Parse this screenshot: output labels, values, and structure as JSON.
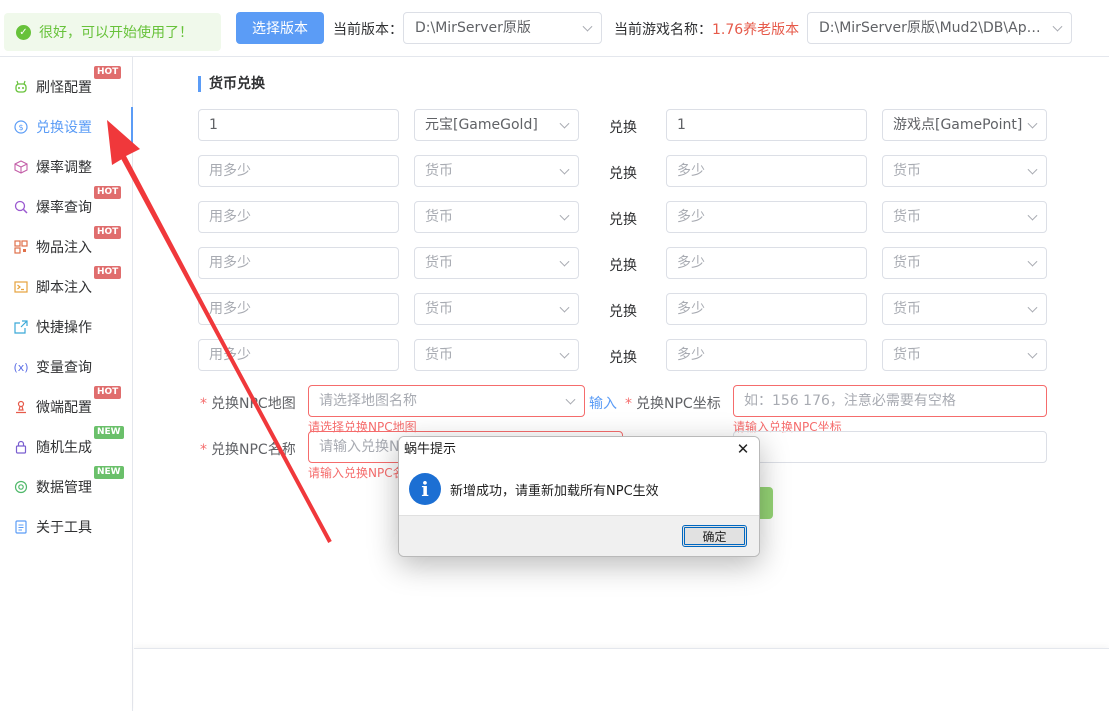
{
  "toast": {
    "text": "很好，可以开始使用了！"
  },
  "topbar": {
    "select_version_button": "选择版本",
    "current_version_label": "当前版本：",
    "current_version_value": "D:\\MirServer原版",
    "game_name_label": "当前游戏名称：",
    "game_name_value": "1.76养老版本",
    "db_path_value": "D:\\MirServer原版\\Mud2\\DB\\Apex..."
  },
  "sidebar": {
    "items": [
      {
        "label": "刷怪配置",
        "icon": "monster-icon",
        "badge": "HOT"
      },
      {
        "label": "兑换设置",
        "icon": "exchange-icon",
        "badge": ""
      },
      {
        "label": "爆率调整",
        "icon": "box-icon",
        "badge": ""
      },
      {
        "label": "爆率查询",
        "icon": "search-icon",
        "badge": "HOT"
      },
      {
        "label": "物品注入",
        "icon": "qrcode-icon",
        "badge": "HOT"
      },
      {
        "label": "脚本注入",
        "icon": "terminal-icon",
        "badge": "HOT"
      },
      {
        "label": "快捷操作",
        "icon": "external-link-icon",
        "badge": ""
      },
      {
        "label": "变量查询",
        "icon": "variable-icon",
        "badge": ""
      },
      {
        "label": "微端配置",
        "icon": "stamp-icon",
        "badge": "HOT"
      },
      {
        "label": "随机生成",
        "icon": "lock-icon",
        "badge": "NEW"
      },
      {
        "label": "数据管理",
        "icon": "database-icon",
        "badge": "NEW"
      },
      {
        "label": "关于工具",
        "icon": "document-icon",
        "badge": ""
      }
    ]
  },
  "section": {
    "title": "货币兑换"
  },
  "exchange": {
    "word": "兑换",
    "rows": [
      {
        "amount_from": "1",
        "currency_from": "元宝[GameGold]",
        "amount_to": "1",
        "currency_to": "游戏点[GamePoint]"
      },
      {
        "amount_from": "",
        "currency_from": "",
        "amount_to": "",
        "currency_to": ""
      },
      {
        "amount_from": "",
        "currency_from": "",
        "amount_to": "",
        "currency_to": ""
      },
      {
        "amount_from": "",
        "currency_from": "",
        "amount_to": "",
        "currency_to": ""
      },
      {
        "amount_from": "",
        "currency_from": "",
        "amount_to": "",
        "currency_to": ""
      },
      {
        "amount_from": "",
        "currency_from": "",
        "amount_to": "",
        "currency_to": ""
      }
    ],
    "placeholder_from": "用多少",
    "placeholder_currency": "货币",
    "placeholder_to": "多少"
  },
  "npc": {
    "map_label": "兑换NPC地图",
    "map_placeholder": "请选择地图名称",
    "map_error": "请选择兑换NPC地图",
    "input_link": "输入",
    "coord_label": "兑换NPC坐标",
    "coord_placeholder": "如：156 176，注意必需要有空格",
    "coord_error": "请输入兑换NPC坐标",
    "name_label": "兑换NPC名称",
    "name_placeholder": "请输入兑换NPC名称",
    "name_error": "请输入兑换NPC名称"
  },
  "dialog": {
    "title": "蜗牛提示",
    "message": "新增成功，请重新加载所有NPC生效",
    "ok_button": "确定"
  },
  "colors": {
    "accent": "#5b9cf6",
    "error": "#f56c6c",
    "success": "#67c23a",
    "hot": "#e06d6d",
    "new": "#6ac06a",
    "arrow": "#f0383b"
  }
}
